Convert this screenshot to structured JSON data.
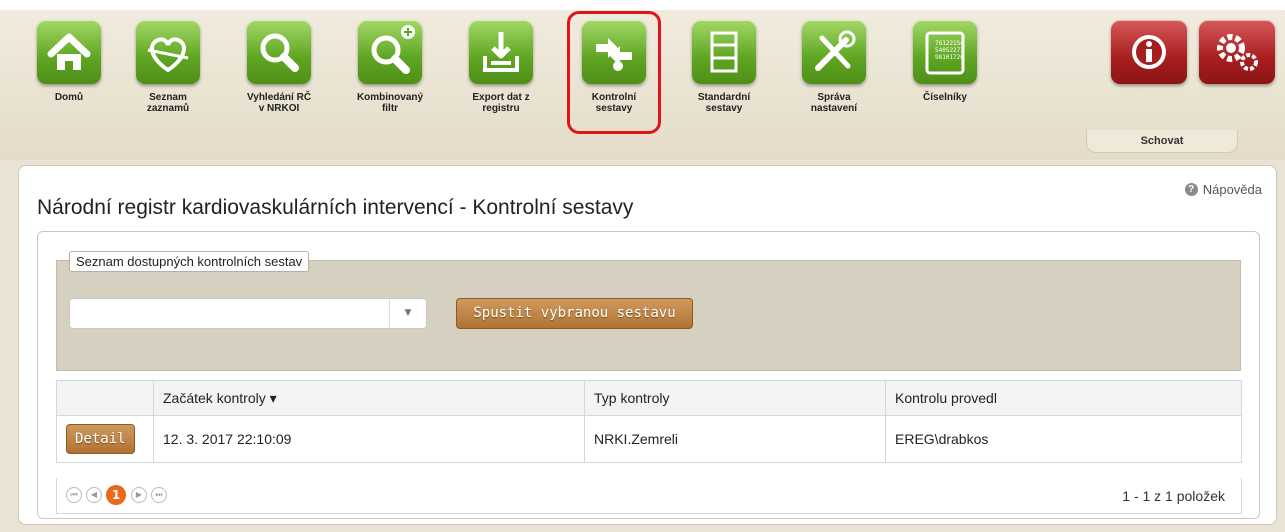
{
  "nav": {
    "items": [
      {
        "label": "Domů",
        "icon": "home-icon"
      },
      {
        "label": "Seznam\nzaznamů",
        "icon": "heart-list-icon"
      },
      {
        "label": "Vyhledání RČ\nv NRKOI",
        "icon": "search-icon"
      },
      {
        "label": "Kombinovaný\nfiltr",
        "icon": "search-plus-icon"
      },
      {
        "label": "Export dat z\nregistru",
        "icon": "export-icon"
      },
      {
        "label": "Kontrolní\nsestavy",
        "icon": "control-report-icon"
      },
      {
        "label": "Standardní\nsestavy",
        "icon": "report-list-icon"
      },
      {
        "label": "Správa\nnastavení",
        "icon": "tools-icon"
      },
      {
        "label": "Číselníky",
        "icon": "codebook-icon"
      }
    ],
    "codebook_digits": [
      "76122154",
      "54052273",
      "98101726"
    ],
    "info_icon": "info-icon",
    "settings_icon": "gears-icon",
    "hide_label": "Schovat",
    "accent_green": "#5ea521",
    "accent_red": "#a81e1e",
    "highlight_color": "#e3131c"
  },
  "page": {
    "help": "Nápověda",
    "title": "Národní registr kardiovaskulárních intervencí - Kontrolní sestavy"
  },
  "filter": {
    "legend": "Seznam dostupných kontrolních sestav",
    "select_value": "",
    "run_button": "Spustit vybranou sestavu"
  },
  "table": {
    "headers": [
      "",
      "Začátek kontroly ▾",
      "Typ kontroly",
      "Kontrolu provedl"
    ],
    "rows": [
      {
        "action": "Detail",
        "start": "12. 3. 2017 22:10:09",
        "type": "NRKI.Zemreli",
        "by": "EREG\\drabkos"
      }
    ]
  },
  "pager": {
    "current_page": "1",
    "info": "1 - 1 z 1 položek",
    "first": "⏮",
    "prev": "◀",
    "next": "▶",
    "last": "⏭"
  }
}
